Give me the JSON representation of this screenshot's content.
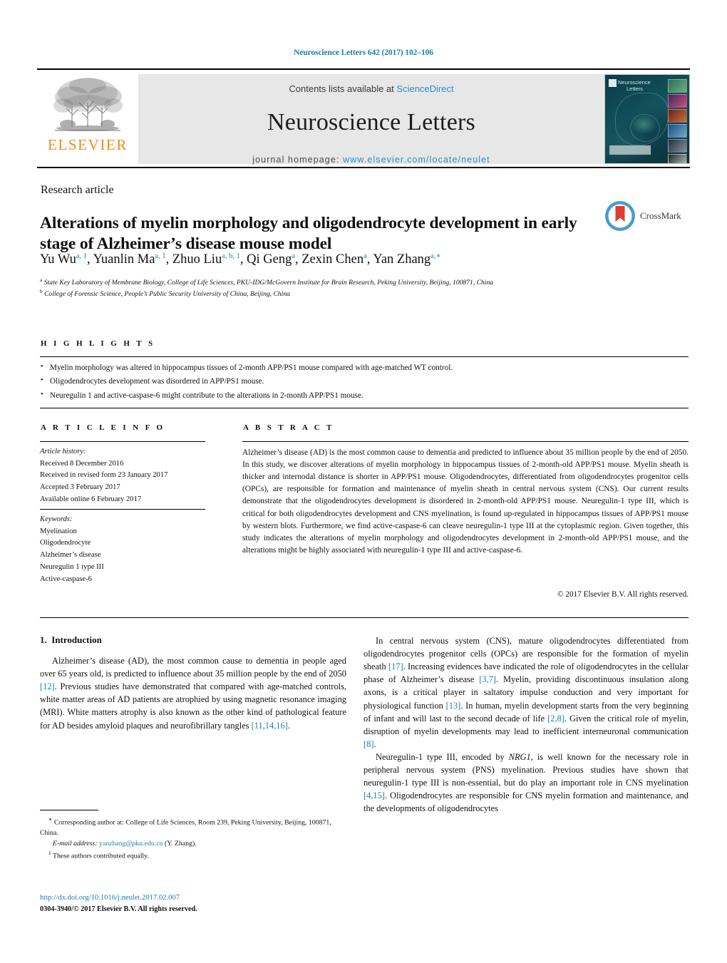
{
  "running_head": "Neuroscience Letters 642 (2017) 102–106",
  "masthead": {
    "publisher_logo_text": "ELSEVIER",
    "contents_prefix": "Contents lists available at ",
    "contents_link": "ScienceDirect",
    "journal_name": "Neuroscience Letters",
    "homepage_prefix": "journal homepage: ",
    "homepage_url": "www.elsevier.com/locate/neulet",
    "cover": {
      "title_line1": "Neuroscience",
      "title_line2": "Letters"
    }
  },
  "article": {
    "type": "Research article",
    "title": "Alterations of myelin morphology and oligodendrocyte development in early stage of Alzheimer’s disease mouse model",
    "crossmark_label": "CrossMark",
    "authors_html": "Yu Wu<sup>a, 1</sup>, Yuanlin Ma<sup>a, 1</sup>, Zhuo Liu<sup>a, b, 1</sup>, Qi Geng<sup>a</sup>, Zexin Chen<sup>a</sup>, Yan Zhang<sup>a,∗</sup>",
    "affiliation_a": "State Key Laboratory of Membrane Biology, College of Life Sciences, PKU-IDG/McGovern Institute for Brain Research, Peking University, Beijing, 100871, China",
    "affiliation_b": "College of Forensic Science, People’s Public Security University of China, Beijing, China"
  },
  "highlights": {
    "heading": "H I G H L I G H T S",
    "items": [
      "Myelin morphology was altered in hippocampus tissues of 2-month APP/PS1 mouse compared with age-matched WT control.",
      "Oligodendrocytes development was disordered in APP/PS1 mouse.",
      "Neuregulin 1 and active-caspase-6 might contribute to the alterations in 2-month APP/PS1 mouse."
    ]
  },
  "article_info": {
    "heading": "A R T I C L E    I N F O",
    "history_label": "Article history:",
    "history": [
      "Received 8 December 2016",
      "Received in revised form 23 January 2017",
      "Accepted 3 February 2017",
      "Available online 6 February 2017"
    ],
    "keywords_label": "Keywords:",
    "keywords": [
      "Myelination",
      "Oligodendrocyte",
      "Alzheimer’s disease",
      "Neuregulin 1 type III",
      "Active-caspase-6"
    ]
  },
  "abstract": {
    "heading": "A B S T R A C T",
    "text": "Alzheimer’s disease (AD) is the most common cause to dementia and predicted to influence about 35 million people by the end of 2050. In this study, we discover alterations of myelin morphology in hippocampus tissues of 2-month-old APP/PS1 mouse. Myelin sheath is thicker and internodal distance is shorter in APP/PS1 mouse. Oligodendrocytes, differentiated from oligodendrocytes progenitor cells (OPCs), are responsible for formation and maintenance of myelin sheath in central nervous system (CNS). Our current results demonstrate that the oligodendrocytes development is disordered in 2-month-old APP/PS1 mouse. Neuregulin-1 type III, which is critical for both oligodendrocytes development and CNS myelination, is found up-regulated in hippocampus tissues of APP/PS1 mouse by western blots. Furthermore, we find active-caspase-6 can cleave neuregulin-1 type III at the cytoplasmic region. Given together, this study indicates the alterations of myelin morphology and oligodendrocytes development in 2-month-old APP/PS1 mouse, and the alterations might be highly associated with neuregulin-1 type III and active-caspase-6.",
    "copyright": "© 2017 Elsevier B.V. All rights reserved."
  },
  "introduction": {
    "section_number": "1.",
    "section_title": "Introduction",
    "left_paragraph_html": "Alzheimer’s disease (AD), the most common cause to dementia in people aged over 65 years old, is predicted to influence about 35 million people by the end of 2050 <span class=\"ref\">[12]</span>. Previous studies have demonstrated that compared with age-matched controls, white matter areas of AD patients are atrophied by using magnetic resonance imaging (MRI). White matters atrophy is also known as the other kind of pathological feature for AD besides amyloid plaques and neurofibrillary tangles <span class=\"ref\">[11,14,16]</span>.",
    "right_paragraph1_html": "In central nervous system (CNS), mature oligodendrocytes differentiated from oligodendrocytes progenitor cells (OPCs) are responsible for the formation of myelin sheath <span class=\"ref\">[17]</span>. Increasing evidences have indicated the role of oligodendrocytes in the cellular phase of Alzheimer’s disease <span class=\"ref\">[3,7]</span>. Myelin, providing discontinuous insulation along axons, is a critical player in saltatory impulse conduction and very important for physiological function <span class=\"ref\">[13]</span>. In human, myelin development starts from the very beginning of infant and will last to the second decade of life <span class=\"ref\">[2,8]</span>. Given the critical role of myelin, disruption of myelin developments may lead to inefficient interneuronal communication <span class=\"ref\">[8]</span>.",
    "right_paragraph2_html": "Neuregulin-1 type III, encoded by <i>NRG1</i>, is well known for the necessary role in peripheral nervous system (PNS) myelination. Previous studies have shown that neuregulin-1 type III is non-essential, but do play an important role in CNS myelination <span class=\"ref\">[4,15]</span>. Oligodendrocytes are responsible for CNS myelin formation and maintenance, and the developments of oligodendrocytes"
  },
  "footnotes": {
    "corresponding_html": "<sup>∗</sup> Corresponding author at: College of Life Sciences, Room 239, Peking University, Beijing, 100871, China.",
    "email_label": "E-mail address:",
    "email_address": "yanzhang@pku.edu.cn",
    "email_suffix": "(Y. Zhang).",
    "equal_contrib_html": "<sup>1</sup> These authors contributed equally."
  },
  "footer": {
    "doi": "http://dx.doi.org/10.1016/j.neulet.2017.02.007",
    "issn_copyright": "0304-3940/© 2017 Elsevier B.V. All rights reserved."
  },
  "colors": {
    "link_blue": "#1a7fad",
    "sciencedirect_blue": "#2b8dc4",
    "elsevier_orange": "#f08a1d",
    "band_gray": "#e7e7e8",
    "crossmark_blue": "#4a9ccd",
    "crossmark_red": "#e03c31"
  }
}
